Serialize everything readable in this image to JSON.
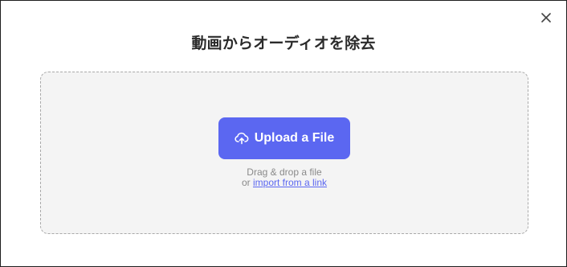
{
  "dialog": {
    "title": "動画からオーディオを除去",
    "close_icon": "close-icon"
  },
  "dropzone": {
    "upload_button_label": "Upload a File",
    "upload_icon": "cloud-upload-icon",
    "drag_text": "Drag & drop a file",
    "or_text": "or",
    "import_link_text": "import from a link"
  },
  "colors": {
    "accent": "#5b67f1",
    "dropzone_bg": "#f4f4f4",
    "title": "#2b2b2b",
    "hint": "#8a8a8a"
  }
}
